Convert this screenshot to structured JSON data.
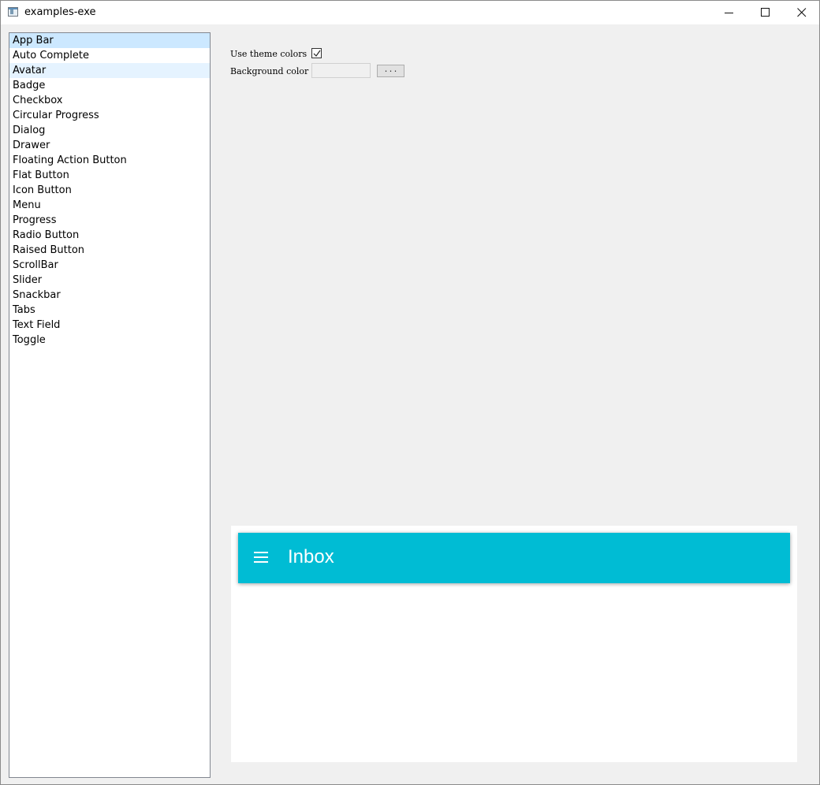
{
  "window": {
    "title": "examples-exe",
    "icon": "app-window-icon",
    "controls": [
      "minimize-icon",
      "maximize-icon",
      "close-icon"
    ]
  },
  "sidebar": {
    "items": [
      {
        "label": "App Bar",
        "state": "selected"
      },
      {
        "label": "Auto Complete",
        "state": ""
      },
      {
        "label": "Avatar",
        "state": "hover"
      },
      {
        "label": "Badge",
        "state": ""
      },
      {
        "label": "Checkbox",
        "state": ""
      },
      {
        "label": "Circular Progress",
        "state": ""
      },
      {
        "label": "Dialog",
        "state": ""
      },
      {
        "label": "Drawer",
        "state": ""
      },
      {
        "label": "Floating Action Button",
        "state": ""
      },
      {
        "label": "Flat Button",
        "state": ""
      },
      {
        "label": "Icon Button",
        "state": ""
      },
      {
        "label": "Menu",
        "state": ""
      },
      {
        "label": "Progress",
        "state": ""
      },
      {
        "label": "Radio Button",
        "state": ""
      },
      {
        "label": "Raised Button",
        "state": ""
      },
      {
        "label": "ScrollBar",
        "state": ""
      },
      {
        "label": "Slider",
        "state": ""
      },
      {
        "label": "Snackbar",
        "state": ""
      },
      {
        "label": "Tabs",
        "state": ""
      },
      {
        "label": "Text Field",
        "state": ""
      },
      {
        "label": "Toggle",
        "state": ""
      }
    ]
  },
  "options": {
    "use_theme_colors_label": "Use theme colors",
    "use_theme_colors_checked": true,
    "background_color_label": "Background color",
    "background_color_value": "",
    "browse_button_label": "..."
  },
  "preview": {
    "appbar_title": "Inbox",
    "appbar_color": "#00bcd4",
    "nav_icon": "hamburger-menu-icon"
  },
  "colors": {
    "selected_item": "#cce8ff",
    "hover_item": "#e5f3ff",
    "window_background": "#f0f0f0"
  }
}
